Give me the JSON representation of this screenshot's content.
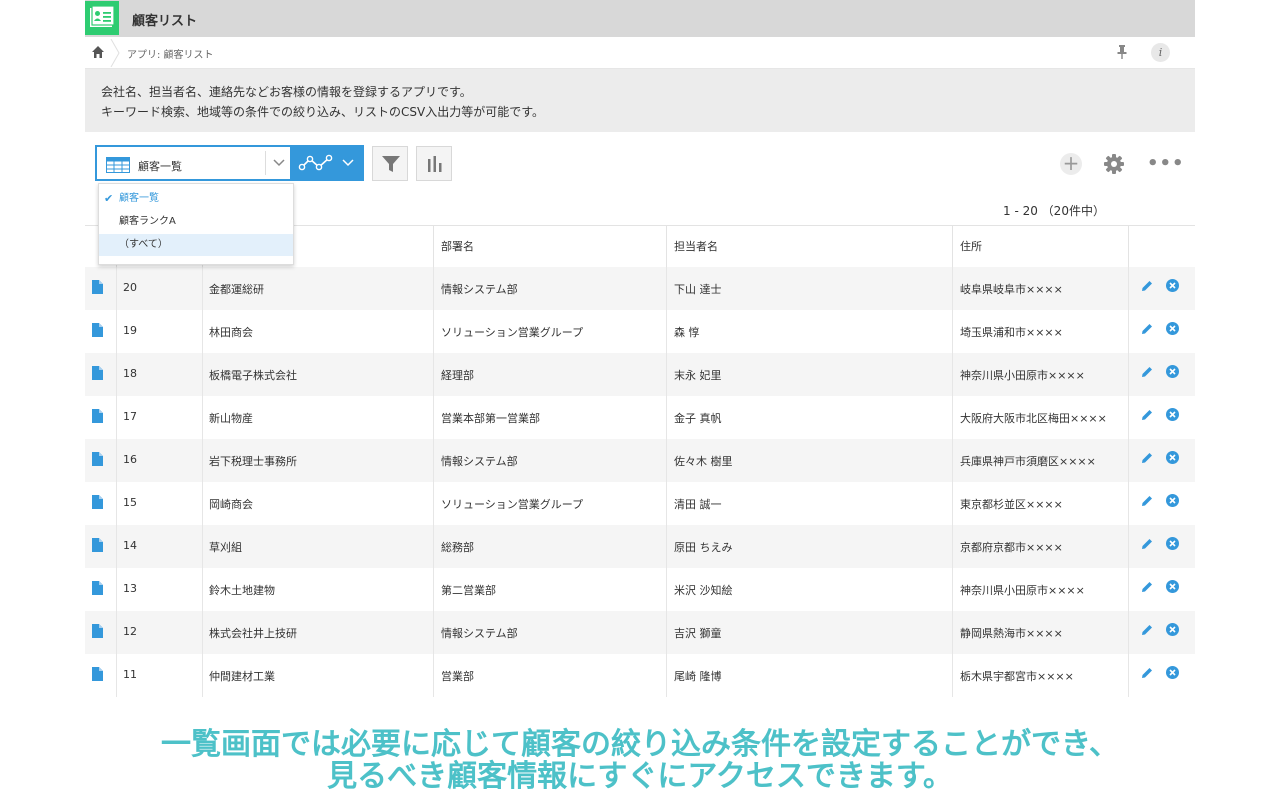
{
  "header": {
    "title": "顧客リスト"
  },
  "breadcrumb": {
    "path": "アプリ: 顧客リスト"
  },
  "description": {
    "line1": "会社名、担当者名、連絡先などお客様の情報を登録するアプリです。",
    "line2": "キーワード検索、地域等の条件での絞り込み、リストのCSV入出力等が可能です。"
  },
  "toolbar": {
    "view_label": "顧客一覧",
    "more": "•••"
  },
  "pager": {
    "text": "1 - 20 （20件中）"
  },
  "columns": {
    "company": "部署名",
    "dept": "部署名",
    "person": "担当者名",
    "address": "住所"
  },
  "dropdown": {
    "items": [
      {
        "label": "顧客一覧",
        "selected": true
      },
      {
        "label": "顧客ランクA",
        "selected": false
      },
      {
        "label": "（すべて）",
        "selected": false
      }
    ]
  },
  "rows": [
    {
      "id": "20",
      "company": "金都運総研",
      "dept": "情報システム部",
      "person": "下山 達士",
      "address": "岐阜県岐阜市××××"
    },
    {
      "id": "19",
      "company": "林田商会",
      "dept": "ソリューション営業グループ",
      "person": "森 惇",
      "address": "埼玉県浦和市××××"
    },
    {
      "id": "18",
      "company": "板橋電子株式会社",
      "dept": "経理部",
      "person": "末永 妃里",
      "address": "神奈川県小田原市××××"
    },
    {
      "id": "17",
      "company": "新山物産",
      "dept": "営業本部第一営業部",
      "person": "金子 真帆",
      "address": "大阪府大阪市北区梅田××××"
    },
    {
      "id": "16",
      "company": "岩下税理士事務所",
      "dept": "情報システム部",
      "person": "佐々木 樹里",
      "address": "兵庫県神戸市須磨区××××"
    },
    {
      "id": "15",
      "company": "岡崎商会",
      "dept": "ソリューション営業グループ",
      "person": "清田 誠一",
      "address": "東京都杉並区××××"
    },
    {
      "id": "14",
      "company": "草刈組",
      "dept": "総務部",
      "person": "原田 ちえみ",
      "address": "京都府京都市××××"
    },
    {
      "id": "13",
      "company": "鈴木土地建物",
      "dept": "第二営業部",
      "person": "米沢 沙知絵",
      "address": "神奈川県小田原市××××"
    },
    {
      "id": "12",
      "company": "株式会社井上技研",
      "dept": "情報システム部",
      "person": "吉沢 獅童",
      "address": "静岡県熱海市××××"
    },
    {
      "id": "11",
      "company": "仲間建材工業",
      "dept": "営業部",
      "person": "尾崎 隆博",
      "address": "栃木県宇都宮市××××"
    }
  ],
  "caption": {
    "line1": "一覧画面では必要に応じて顧客の絞り込み条件を設定することができ、",
    "line2": "見るべき顧客情報にすぐにアクセスできます。"
  },
  "colors": {
    "accent": "#3498db",
    "caption": "#4dc1c8",
    "app_icon": "#2ecc71"
  }
}
